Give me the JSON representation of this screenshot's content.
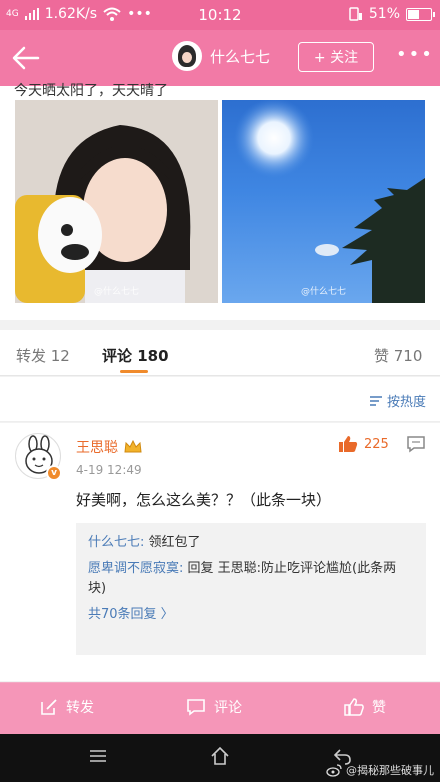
{
  "status_bar": {
    "network_type": "4G",
    "speed": "1.62K/s",
    "dots": "•••",
    "time": "10:12",
    "battery": "51%",
    "battery_level": 0.51
  },
  "navbar": {
    "username": "什么七七",
    "follow_label": "+ 关注",
    "more_label": "•••"
  },
  "post": {
    "text": "今天晒太阳了，天天晴了",
    "photo_watermark_1": "@什么七七",
    "photo_watermark_2": "@什么七七"
  },
  "tabs": {
    "repost": "转发 12",
    "comments": "评论 180",
    "likes": "赞 710"
  },
  "sort": {
    "label": "按热度"
  },
  "comment": {
    "author": "王思聪",
    "time": "4-19 12:49",
    "likes": "225",
    "text": "好美啊，怎么这么美？？（此条一块）",
    "replies": [
      {
        "name": "什么七七:",
        "text": " 领红包了"
      },
      {
        "name": "愿卑调不愿寂寞:",
        "text": " 回复 王思聪:防止吃评论尴尬(此条两块)"
      }
    ],
    "more_replies": "共70条回复 〉"
  },
  "toolbar": {
    "repost": "转发",
    "comment": "评论",
    "like": "赞"
  },
  "watermark": {
    "text": "@揭秘那些破事儿"
  },
  "colors": {
    "pink": "#f27aa6",
    "orange": "#e96a2a",
    "link_blue": "#4a7bb7"
  }
}
